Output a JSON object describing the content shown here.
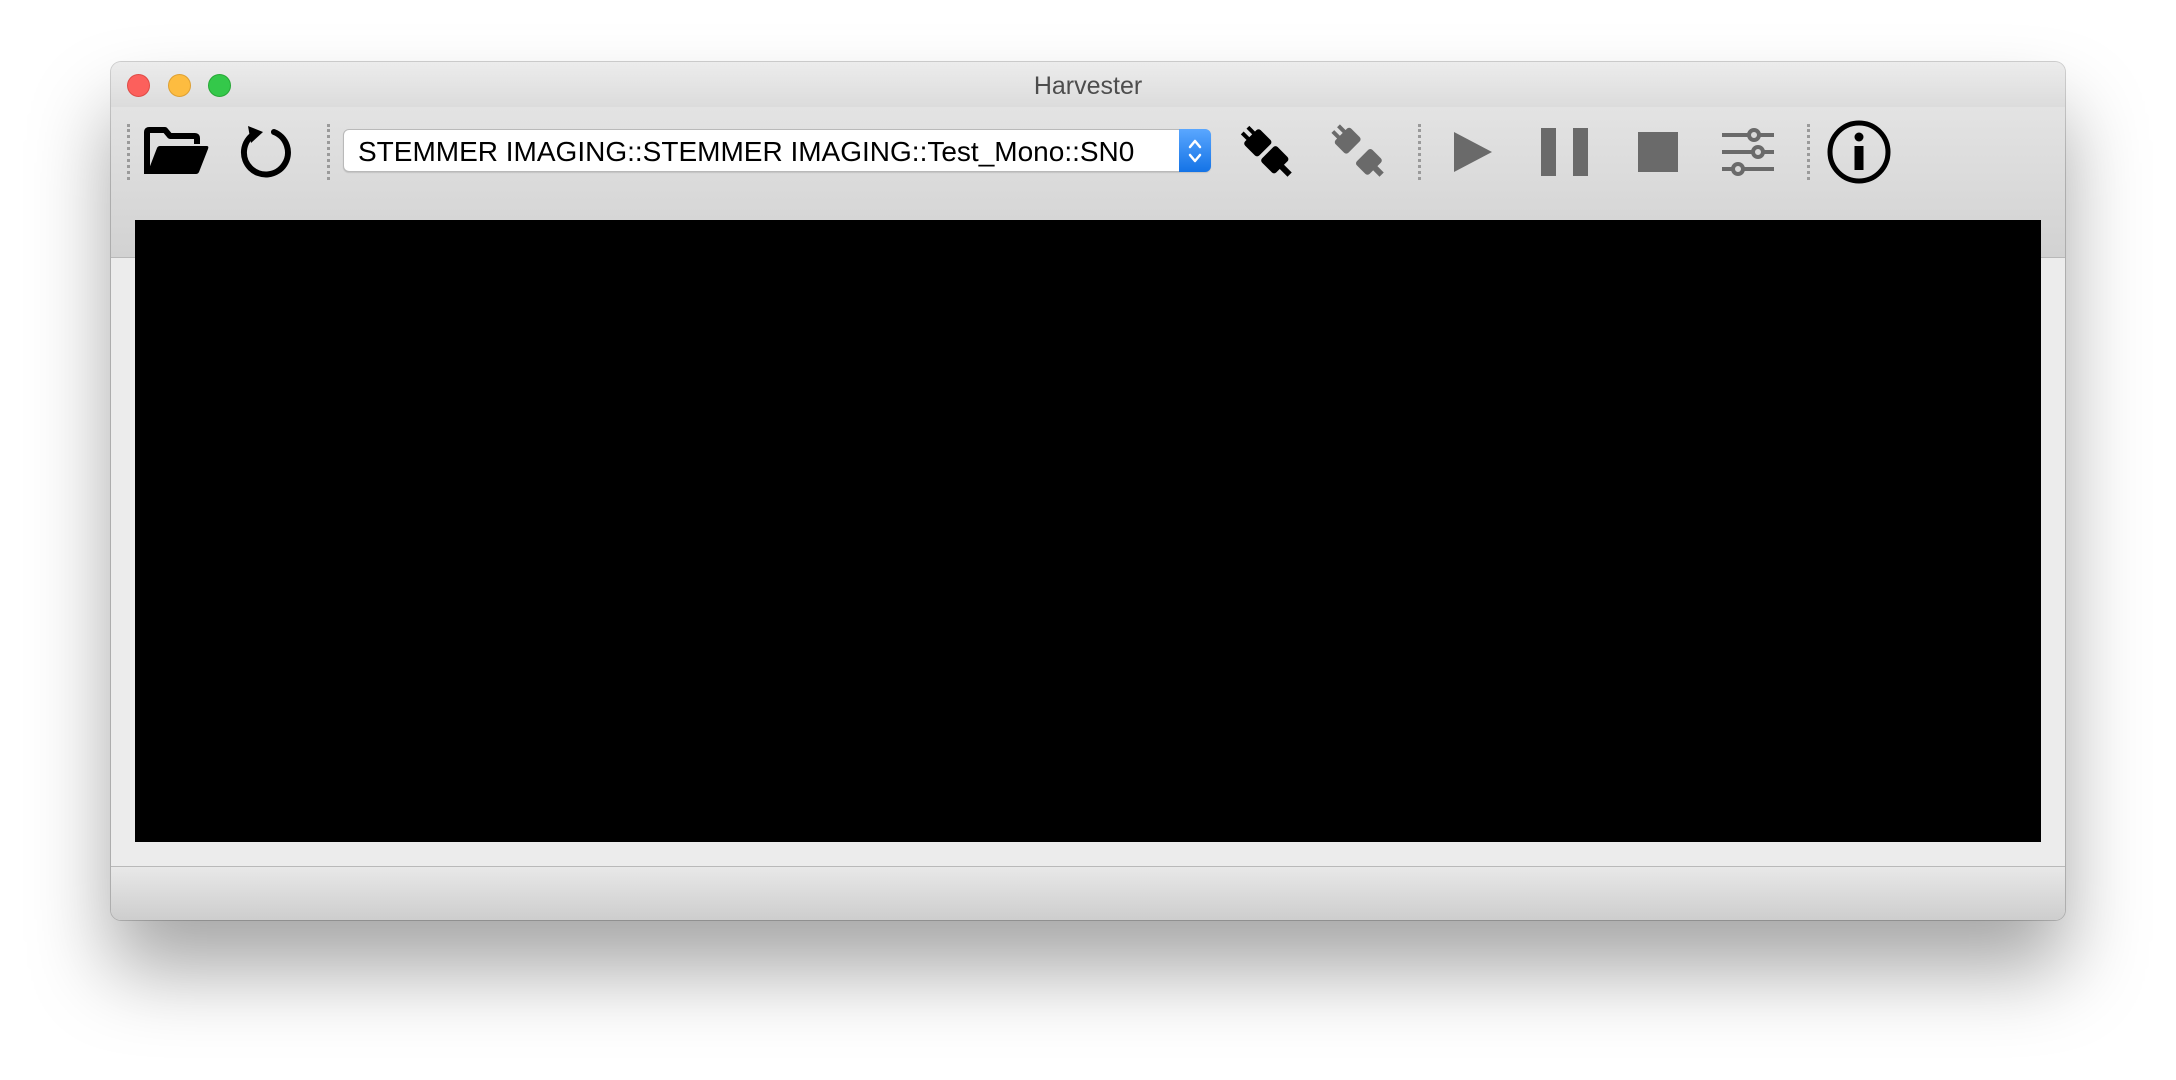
{
  "window": {
    "title": "Harvester"
  },
  "toolbar": {
    "device_combo": {
      "selected": "STEMMER IMAGING::STEMMER IMAGING::Test_Mono::SN0"
    },
    "icons": [
      "folder-open-icon",
      "refresh-icon",
      "connect-icon",
      "disconnect-icon",
      "play-icon",
      "pause-icon",
      "stop-icon",
      "sliders-icon",
      "info-icon"
    ]
  },
  "colors": {
    "close": "#fc605c",
    "minimize": "#fdbc40",
    "maximize": "#34c84a",
    "combo_arrow": "#1f7ff0",
    "disabled_icon": "#6a6a6a",
    "viewport": "#000000"
  }
}
